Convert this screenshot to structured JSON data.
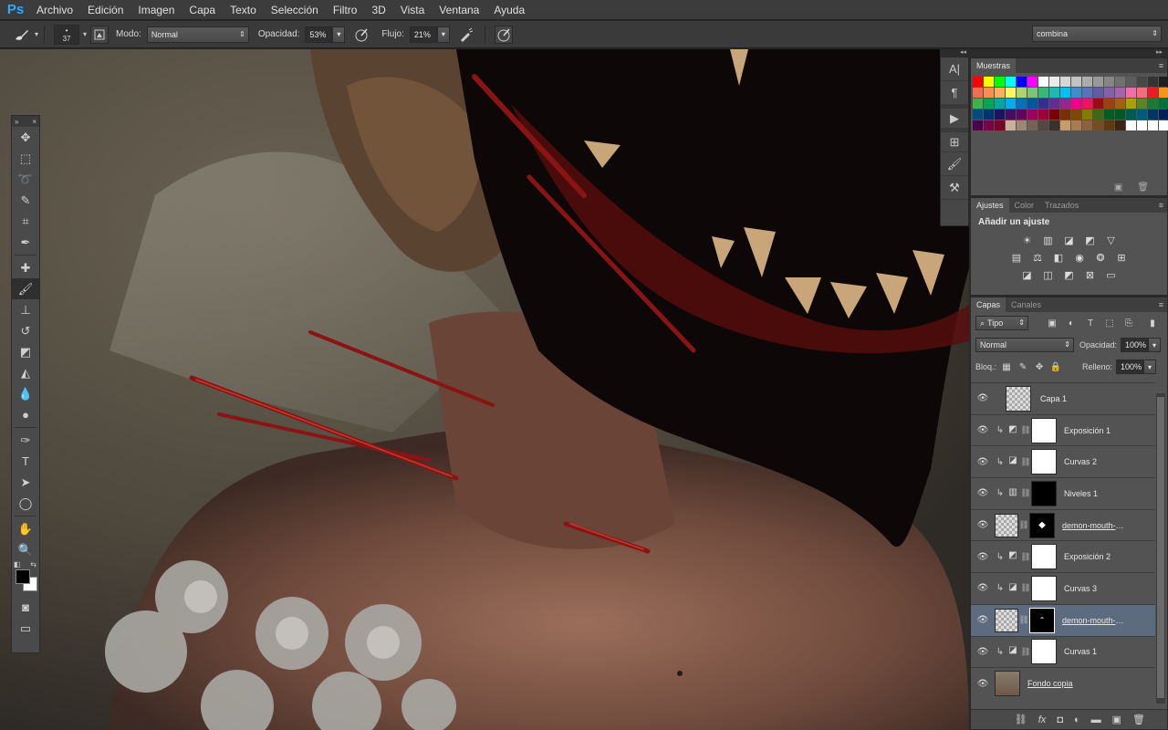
{
  "app": {
    "logo": "Ps",
    "menu": [
      "Archivo",
      "Edición",
      "Imagen",
      "Capa",
      "Texto",
      "Selección",
      "Filtro",
      "3D",
      "Vista",
      "Ventana",
      "Ayuda"
    ]
  },
  "options": {
    "brush_size": "37",
    "mode_label": "Modo:",
    "mode_value": "Normal",
    "opacity_label": "Opacidad:",
    "opacity_value": "53%",
    "flow_label": "Flujo:",
    "flow_value": "21%",
    "workspace": "combina"
  },
  "swatches_panel": {
    "tab": "Muestras",
    "colors": [
      "#ff0000",
      "#ffff00",
      "#00ff00",
      "#00ffff",
      "#0000ff",
      "#ff00ff",
      "#ffffff",
      "#ebebeb",
      "#d6d6d6",
      "#c2c2c2",
      "#adadad",
      "#999999",
      "#858585",
      "#707070",
      "#5c5c5c",
      "#474747",
      "#333333",
      "#1f1f1f",
      "#ff0000",
      "#ffee00",
      "#f26c4f",
      "#f68e55",
      "#fbaf5d",
      "#fff467",
      "#acd372",
      "#7cc576",
      "#3bb878",
      "#1abbb4",
      "#00bff3",
      "#438ccb",
      "#5574b9",
      "#605ca8",
      "#855fa8",
      "#a763a8",
      "#f06ea9",
      "#f26d7d",
      "#ed1c24",
      "#f7941d",
      "#fff200",
      "#8dc63f",
      "#39b54a",
      "#00a651",
      "#00a99d",
      "#00aeef",
      "#0072bc",
      "#0054a6",
      "#2e3192",
      "#662d91",
      "#92278f",
      "#ec008c",
      "#ed145b",
      "#9e0b0f",
      "#a0410d",
      "#a36209",
      "#aba000",
      "#598527",
      "#1a7b30",
      "#007236",
      "#00746b",
      "#0076a3",
      "#004b80",
      "#003471",
      "#1b1464",
      "#440e62",
      "#630460",
      "#9e005d",
      "#9e0039",
      "#790000",
      "#7b2e00",
      "#7d4900",
      "#827b00",
      "#406618",
      "#005e20",
      "#005826",
      "#005952",
      "#005b7f",
      "#003663",
      "#002157",
      "#0d004c",
      "#32004b",
      "#4b0049",
      "#7b0046",
      "#7a0026",
      "#c7b299",
      "#998675",
      "#736357",
      "#534741",
      "#37302d",
      "#c69c6d",
      "#a67c52",
      "#8c6239",
      "#754c24",
      "#603913",
      "#3c2415",
      "#ffffff",
      "#ffffff",
      "#ffffff",
      "#ffffff",
      "#ffffff",
      "#ffffff"
    ]
  },
  "adjust_panel": {
    "tabs": [
      "Ajustes",
      "Color",
      "Trazados"
    ],
    "title": "Añadir un ajuste"
  },
  "layers_panel": {
    "tabs": [
      "Capas",
      "Canales"
    ],
    "filter_kind": "Tipo",
    "blend_mode": "Normal",
    "opacity_label": "Opacidad:",
    "opacity_value": "100%",
    "lock_label": "Bloq.:",
    "fill_label": "Relleno:",
    "fill_value": "100%",
    "layers": [
      {
        "name": "Capa 1"
      },
      {
        "name": "Exposición 1"
      },
      {
        "name": "Curvas 2"
      },
      {
        "name": "Niveles 1"
      },
      {
        "name": "demon-mouth-wit..."
      },
      {
        "name": "Exposición 2"
      },
      {
        "name": "Curvas 3"
      },
      {
        "name": "demon-mouth-wit..."
      },
      {
        "name": "Curvas 1"
      },
      {
        "name": "Fondo copia"
      }
    ]
  }
}
